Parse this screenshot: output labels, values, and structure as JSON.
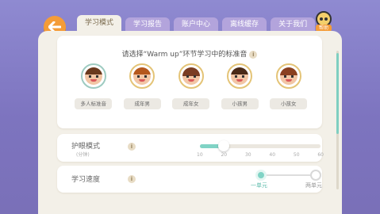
{
  "help": {
    "label": "帮助"
  },
  "tabs": [
    {
      "label": "学习模式",
      "active": true
    },
    {
      "label": "学习报告",
      "active": false
    },
    {
      "label": "账户中心",
      "active": false
    },
    {
      "label": "离线缓存",
      "active": false
    },
    {
      "label": "关于我们",
      "active": false
    }
  ],
  "voice": {
    "title": "请选择“Warm up”环节学习中的标准音",
    "info_icon": "i",
    "options": [
      {
        "label": "多人标准音",
        "selected": true
      },
      {
        "label": "成年男",
        "selected": false
      },
      {
        "label": "成年女",
        "selected": false
      },
      {
        "label": "小孩男",
        "selected": false
      },
      {
        "label": "小孩女",
        "selected": false
      }
    ]
  },
  "eye_mode": {
    "label": "护眼模式",
    "sub": "(分钟)",
    "info_icon": "i",
    "ticks": [
      "10",
      "20",
      "30",
      "40",
      "50",
      "60"
    ],
    "value": 20
  },
  "speed": {
    "label": "学习速度",
    "info_icon": "i",
    "options": [
      "一单元",
      "两单元"
    ],
    "selected": "一单元"
  },
  "colors": {
    "accent": "#80d3c5",
    "back_button": "#f49c38",
    "background": "#8f8ad1"
  }
}
